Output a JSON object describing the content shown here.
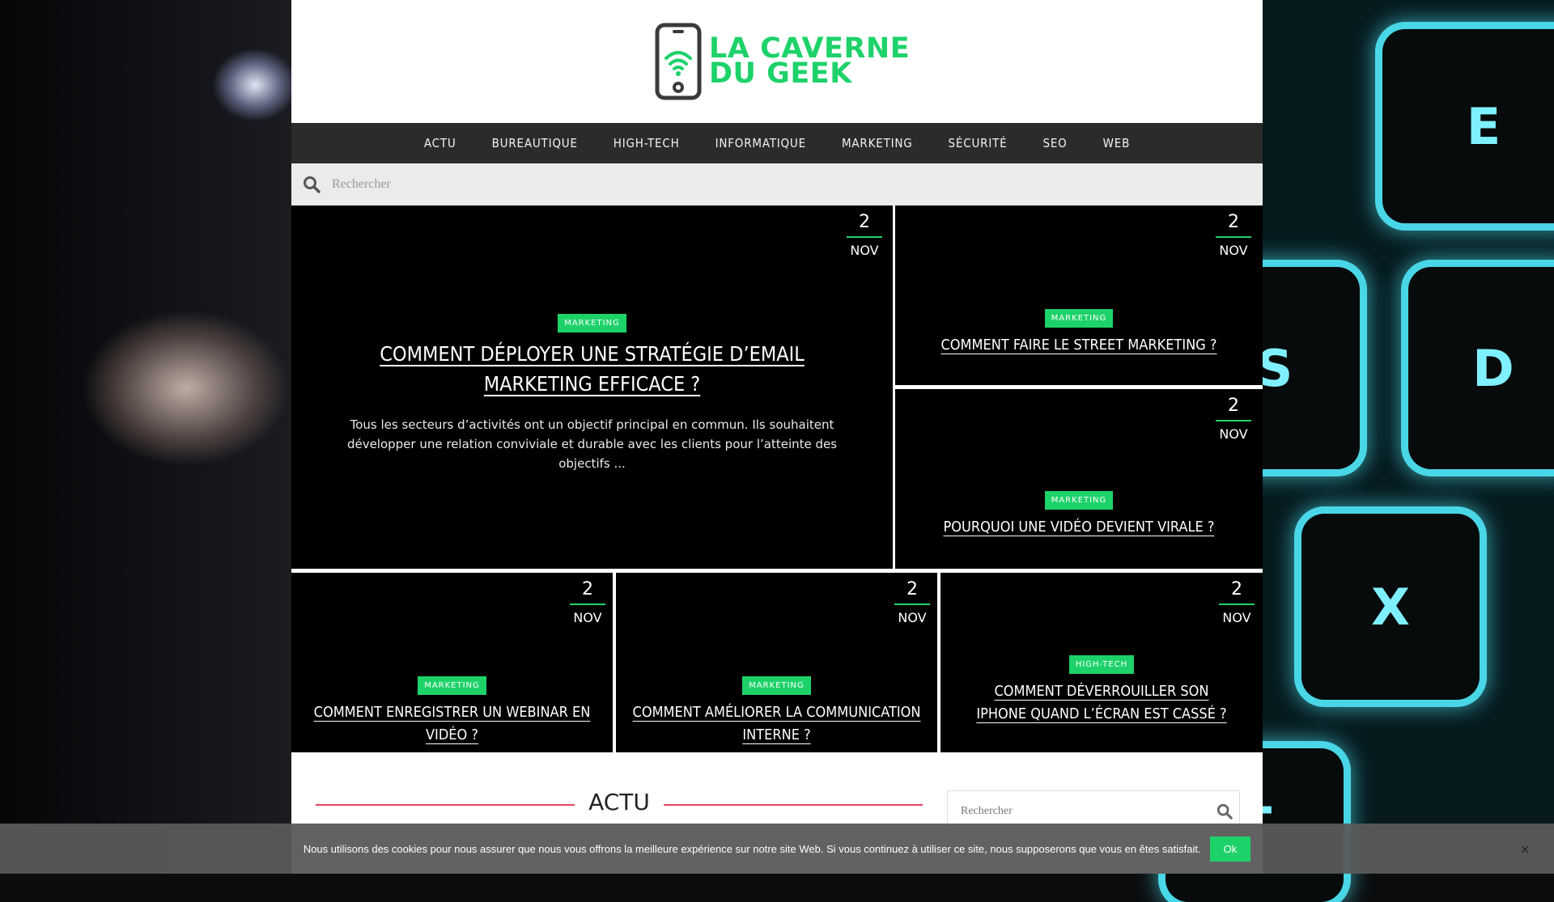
{
  "site": {
    "logo_line1": "LA CAVERNE",
    "logo_line2": "DU GEEK",
    "accent": "#1ed26a"
  },
  "nav": {
    "items": [
      "ACTU",
      "BUREAUTIQUE",
      "HIGH-TECH",
      "INFORMATIQUE",
      "MARKETING",
      "SÉCURITÉ",
      "SEO",
      "WEB"
    ]
  },
  "search": {
    "placeholder": "Rechercher"
  },
  "featured": [
    {
      "day": "2",
      "month": "NOV",
      "category": "MARKETING",
      "title": "COMMENT DÉPLOYER UNE STRATÉGIE D’EMAIL MARKETING EFFICACE ?",
      "excerpt": "Tous les secteurs d’activités ont un objectif principal en commun. Ils souhaitent développer une relation conviviale et durable avec les clients pour l’atteinte des objectifs ..."
    },
    {
      "day": "2",
      "month": "NOV",
      "category": "MARKETING",
      "title": "COMMENT FAIRE LE STREET MARKETING ?"
    },
    {
      "day": "2",
      "month": "NOV",
      "category": "MARKETING",
      "title": "POURQUOI UNE VIDÉO DEVIENT VIRALE ?"
    },
    {
      "day": "2",
      "month": "NOV",
      "category": "MARKETING",
      "title": "COMMENT ENREGISTRER UN WEBINAR EN VIDÉO ?"
    },
    {
      "day": "2",
      "month": "NOV",
      "category": "MARKETING",
      "title": "COMMENT AMÉLIORER LA COMMUNICATION INTERNE ?"
    },
    {
      "day": "2",
      "month": "NOV",
      "category": "HIGH-TECH",
      "title": "COMMENT DÉVERROUILLER SON IPHONE QUAND L’ÉCRAN EST CASSÉ ?"
    }
  ],
  "section": {
    "title": "ACTU"
  },
  "sidebar": {
    "search_placeholder": "Rechercher"
  },
  "cookie": {
    "text": "Nous utilisons des cookies pour nous assurer que nous vous offrons la meilleure expérience sur notre site Web. Si vous continuez à utiliser ce site, nous supposerons que vous en êtes satisfait.",
    "ok_label": "Ok",
    "close_label": "×"
  },
  "background_keys": [
    "E",
    "S",
    "D",
    "X",
    "T"
  ]
}
